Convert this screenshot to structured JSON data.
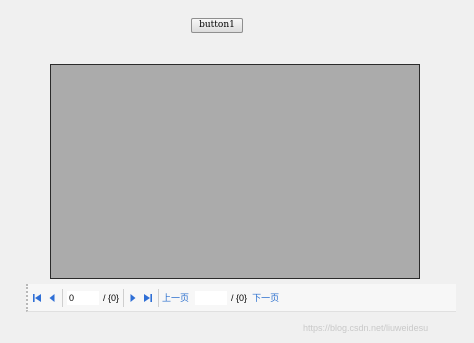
{
  "toolbar": {
    "button1_label": "button1"
  },
  "pager": {
    "current_page_value": "0",
    "total_pages_text": "/ {0}",
    "prev_page_label": "上一页",
    "goto_page_value": "",
    "goto_total_text": "/ {0}",
    "next_page_label": "下一页"
  },
  "icons": {
    "first": "first-page-icon",
    "prev": "previous-page-icon",
    "next": "next-page-icon",
    "last": "last-page-icon"
  },
  "colors": {
    "icon_blue": "#2f6fd6",
    "link_blue": "#2a6fce",
    "grid_background": "#ababab"
  },
  "watermark": {
    "text": "https://blog.csdn.net/liuweidesu"
  }
}
